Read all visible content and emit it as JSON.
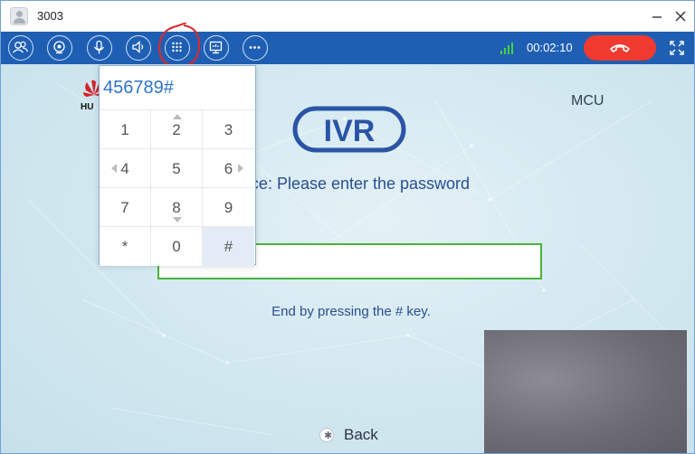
{
  "window": {
    "title": "3003"
  },
  "toolbar": {
    "buttons": [
      "participants-icon",
      "camera-icon",
      "microphone-icon",
      "speaker-icon",
      "dialpad-icon",
      "share-screen-icon",
      "more-icon"
    ],
    "call_timer": "00:02:10",
    "colors": {
      "bar": "#1f5fb3",
      "hangup": "#f03a2f",
      "signal": "#46d23c"
    }
  },
  "dialpad": {
    "entered_digits": "456789#",
    "keys": [
      "1",
      "2",
      "3",
      "4",
      "5",
      "6",
      "7",
      "8",
      "9",
      "*",
      "0",
      "#"
    ],
    "active_key": "#"
  },
  "stage": {
    "brand_partial": "HU",
    "mcu_label": "MCU",
    "ivr_logo_text": "IVR",
    "prompt": "ence: Please enter the password",
    "end_hint": "End by pressing the # key.",
    "back_label": "Back"
  }
}
